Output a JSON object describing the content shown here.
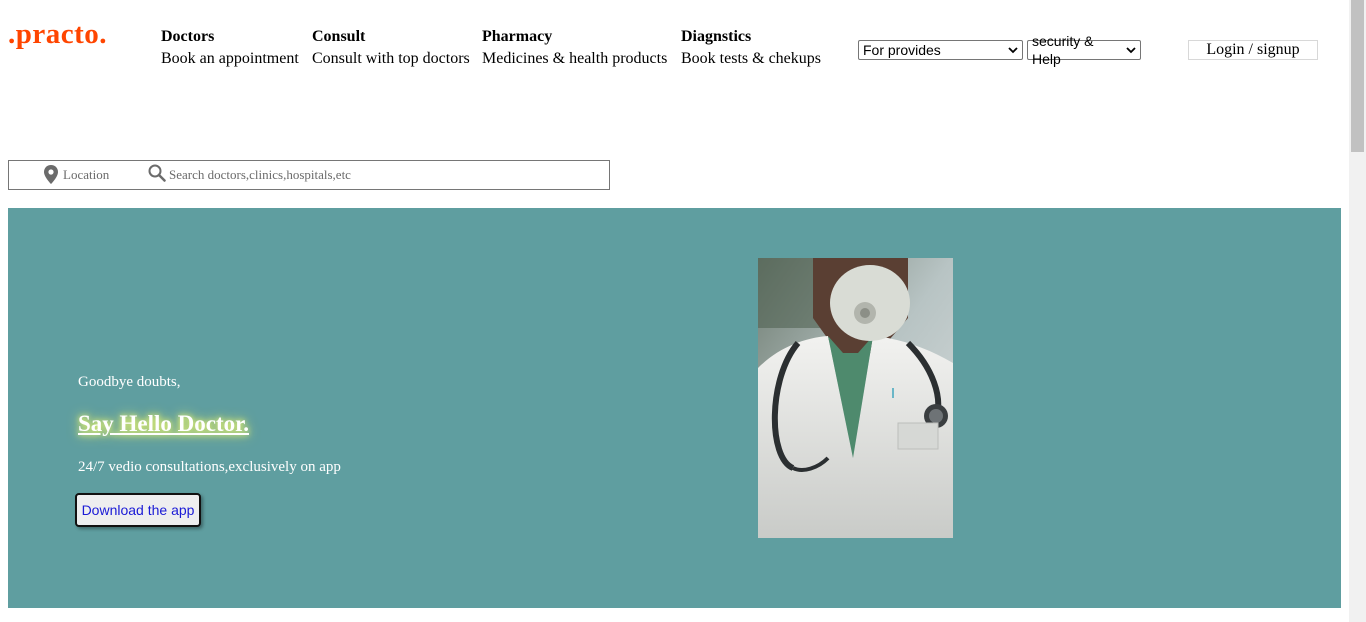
{
  "logo": ".practo.",
  "nav": [
    {
      "title": "Doctors",
      "sub": "Book an appointment"
    },
    {
      "title": "Consult",
      "sub": "Consult with top doctors"
    },
    {
      "title": "Pharmacy",
      "sub": "Medicines & health products"
    },
    {
      "title": "Diagnstics",
      "sub": "Book tests & chekups"
    }
  ],
  "selects": {
    "providers": "For provides",
    "security": "security & Help"
  },
  "login": "Login / signup",
  "search": {
    "location_placeholder": "Location",
    "query_placeholder": "Search doctors,clinics,hospitals,etc"
  },
  "hero": {
    "greeting": "Goodbye doubts,",
    "heading": "Say Hello Doctor.",
    "sub": "24/7 vedio consultations,exclusively on app",
    "button": "Download the app"
  },
  "colors": {
    "brand": "#ff4500",
    "hero_bg": "#5f9ea0",
    "button_text": "#1a1ad6"
  },
  "icons": [
    "location-pin-icon",
    "search-icon",
    "chevron-down-icon"
  ]
}
